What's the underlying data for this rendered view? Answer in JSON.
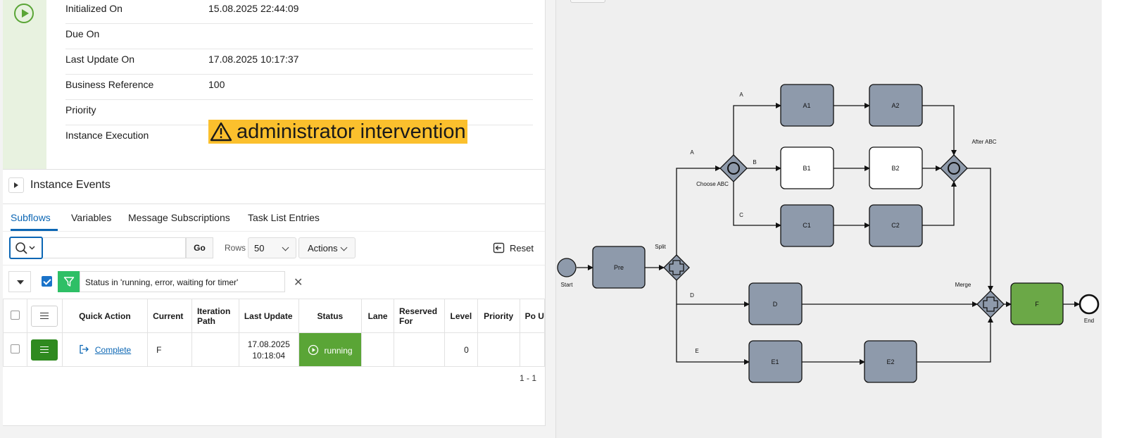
{
  "details": [
    {
      "label": "Initialized On",
      "value": "15.08.2025 22:44:09"
    },
    {
      "label": "Due On",
      "value": ""
    },
    {
      "label": "Last Update On",
      "value": "17.08.2025 10:17:37"
    },
    {
      "label": "Business Reference",
      "value": "100"
    },
    {
      "label": "Priority",
      "value": ""
    },
    {
      "label": "Instance Execution",
      "value": "administrator intervention"
    }
  ],
  "instance_events": {
    "title": "Instance Events"
  },
  "tabs": [
    "Subflows",
    "Variables",
    "Message Subscriptions",
    "Task List Entries"
  ],
  "toolbar": {
    "go_label": "Go",
    "rows_label": "Rows",
    "rows_value": "50",
    "actions_label": "Actions",
    "reset_label": "Reset",
    "search_value": ""
  },
  "filter": {
    "text": "Status in 'running, error, waiting for timer'"
  },
  "grid": {
    "headers": [
      "Quick Action",
      "Current",
      "Iteration Path",
      "Last Update",
      "Status",
      "Lane",
      "Reserved For",
      "Level",
      "Priority",
      "Po U"
    ],
    "rows": [
      {
        "quick_action": "Complete",
        "current": "F",
        "iteration_path": "",
        "last_update_date": "17.08.2025",
        "last_update_time": "10:18:04",
        "status": "running",
        "lane": "",
        "reserved_for": "",
        "level": "0",
        "priority": ""
      }
    ],
    "pagination": "1 - 1"
  },
  "diagram": {
    "tasks": [
      "Pre",
      "A1",
      "A2",
      "B1",
      "B2",
      "C1",
      "C2",
      "D",
      "E1",
      "E2",
      "F"
    ],
    "events": [
      "Start",
      "End"
    ],
    "gateways": [
      "Split",
      "Choose ABC",
      "After ABC",
      "Merge"
    ],
    "flow_labels": [
      "A",
      "B",
      "C",
      "A",
      "D",
      "E"
    ]
  },
  "colors": {
    "accent": "#0b66b4",
    "running": "#5aa536",
    "warning": "#fbc02d",
    "completed_task": "#8e9aab",
    "current_task": "#6ba847"
  }
}
